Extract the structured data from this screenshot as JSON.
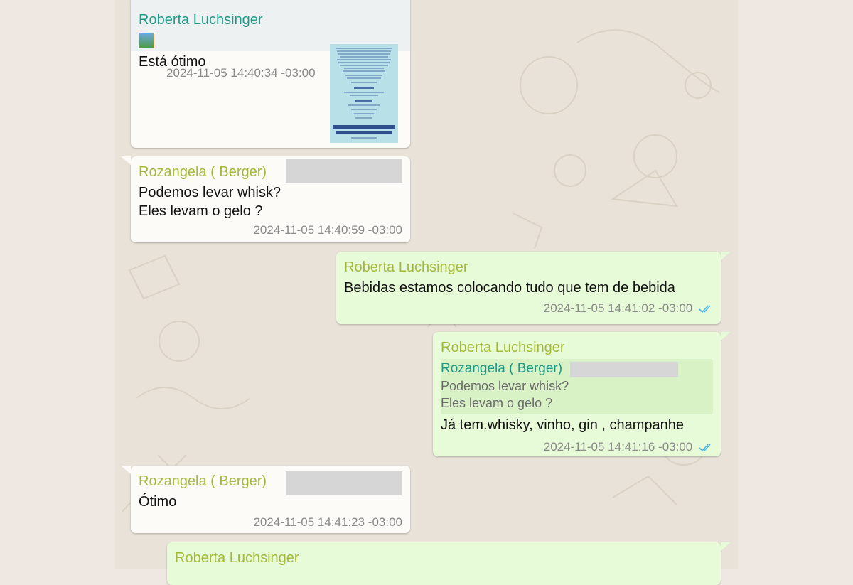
{
  "messages": [
    {
      "sender": "Roberta Luchsinger",
      "text": "Está ótimo",
      "timestamp": "2024-11-05 14:40:34 -03:00",
      "attachment_icon": "image-icon",
      "attachment": "document-image-thumbnail"
    },
    {
      "sender": "Rozangela ( Berger)",
      "lines": [
        "Podemos levar whisk?",
        "Eles levam o gelo ?"
      ],
      "timestamp": "2024-11-05 14:40:59 -03:00"
    },
    {
      "sender": "Roberta Luchsinger",
      "text": "Bebidas estamos colocando tudo que tem de bebida",
      "timestamp": "2024-11-05 14:41:02 -03:00",
      "status_icon": "double-check-icon"
    },
    {
      "sender": "Roberta Luchsinger",
      "quote": {
        "sender": "Rozangela ( Berger)",
        "lines": [
          "Podemos levar whisk?",
          "Eles levam o gelo ?"
        ]
      },
      "text": "Já tem.whisky, vinho, gin , champanhe",
      "timestamp": "2024-11-05 14:41:16 -03:00",
      "status_icon": "double-check-icon"
    },
    {
      "sender": "Rozangela ( Berger)",
      "text": "Ótimo",
      "timestamp": "2024-11-05 14:41:23 -03:00"
    },
    {
      "sender": "Roberta Luchsinger"
    }
  ],
  "colors": {
    "incoming_bubble": "#fcfbf7",
    "outgoing_bubble": "#e8fbd8",
    "sender_name": "#a4b93a",
    "sender_name_alt": "#1e9a86",
    "read_ticks": "#4fb6ec"
  }
}
